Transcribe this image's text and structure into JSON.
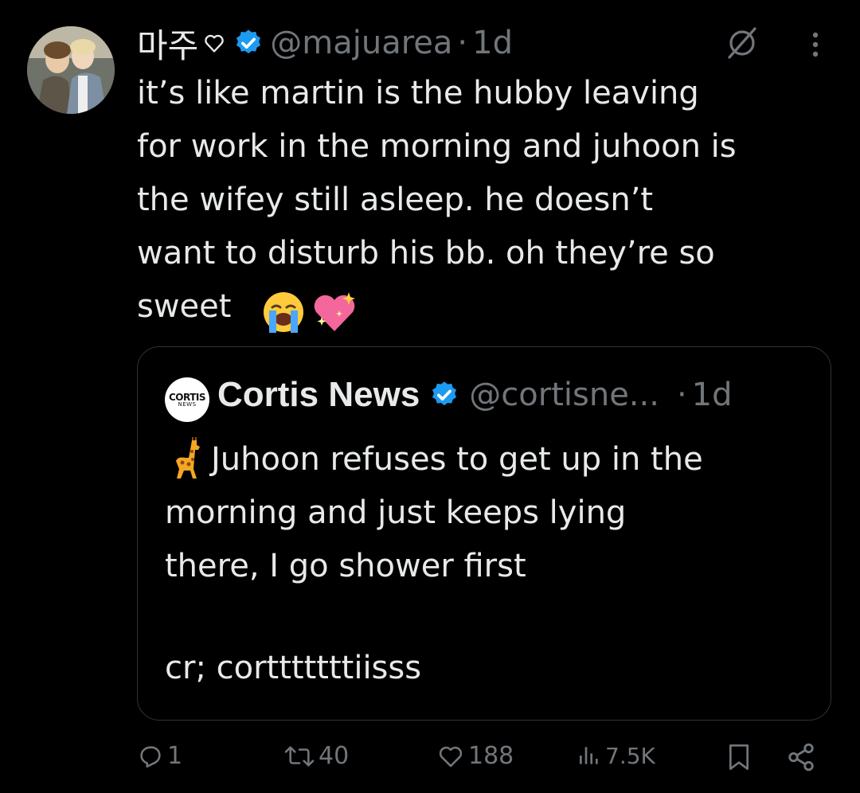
{
  "tweet": {
    "display_name": "마주",
    "handle": "@majuarea",
    "separator": "·",
    "time": "1d",
    "text_lines": [
      "it’s like martin is the hubby leaving",
      "for work in the morning and juhoon is",
      "the wifey still asleep. he doesn’t",
      "want to disturb his bb. oh they’re so",
      "sweet"
    ],
    "emojis": [
      "loudly-crying-face",
      "sparkling-heart"
    ]
  },
  "quote": {
    "avatar_logo_text": "CORTIS",
    "avatar_logo_sub": "NEWS",
    "display_name": "Cortis News",
    "handle": "@cortisne...",
    "separator": "·",
    "time": "1d",
    "text": "Juhoon refuses to get up in the\nmorning and just keeps lying\nthere, I go shower first",
    "credit": "cr; cortttttttiisss"
  },
  "actions": {
    "replies": "1",
    "reposts": "40",
    "likes": "188",
    "views": "7.5K"
  },
  "colors": {
    "background": "#000000",
    "text": "#e7e9ea",
    "muted": "#71767b",
    "verified": "#1d9bf0",
    "border": "#2f3336"
  },
  "icons": [
    "grok-icon",
    "more-icon",
    "verified-icon",
    "heart-outline-icon",
    "giraffe-icon",
    "reply-icon",
    "repost-icon",
    "like-icon",
    "views-icon",
    "bookmark-icon",
    "share-icon"
  ]
}
